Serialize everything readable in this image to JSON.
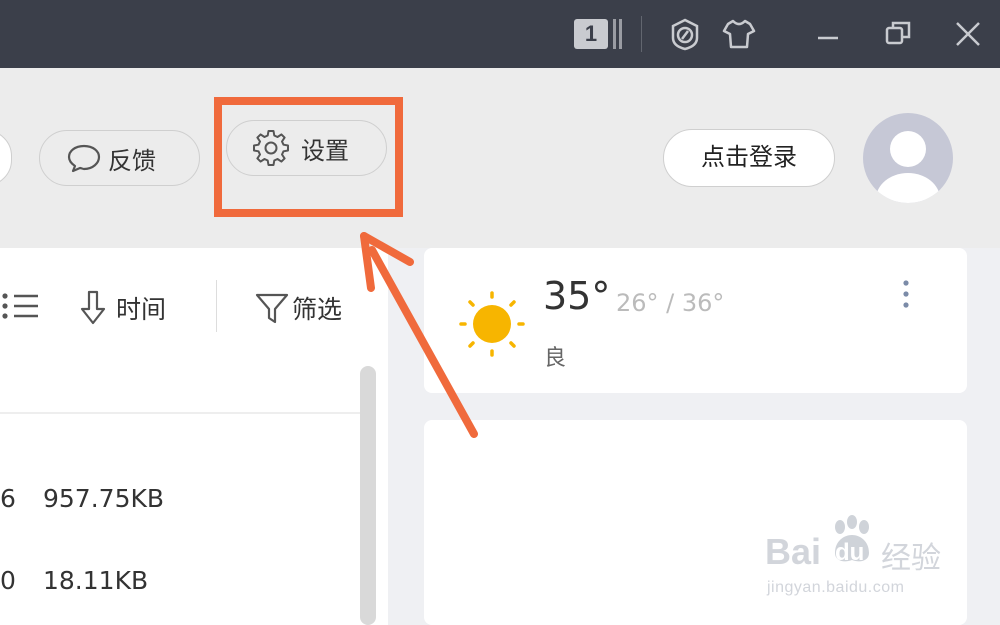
{
  "titlebar": {
    "badge_number": "1",
    "icons": [
      "speed-icon",
      "skin-shirt-icon",
      "minimize-icon",
      "restore-icon",
      "close-icon"
    ]
  },
  "toolbar": {
    "feedback_label": "反馈",
    "settings_label": "设置",
    "login_label": "点击登录"
  },
  "filelist": {
    "sort_label": "时间",
    "filter_label": "筛选",
    "rows": [
      {
        "prefix": "6",
        "size": "957.75KB"
      },
      {
        "prefix": "0",
        "size": "18.11KB"
      }
    ]
  },
  "weather": {
    "temp": "35°",
    "range": "26° / 36°",
    "quality": "良"
  },
  "watermark": {
    "brand": "Bai",
    "brand2": "du",
    "cn": "经验",
    "url": "jingyan.baidu.com"
  },
  "colors": {
    "titlebar": "#3b3f4a",
    "highlight": "#f06a3c",
    "sun": "#f7b500"
  }
}
